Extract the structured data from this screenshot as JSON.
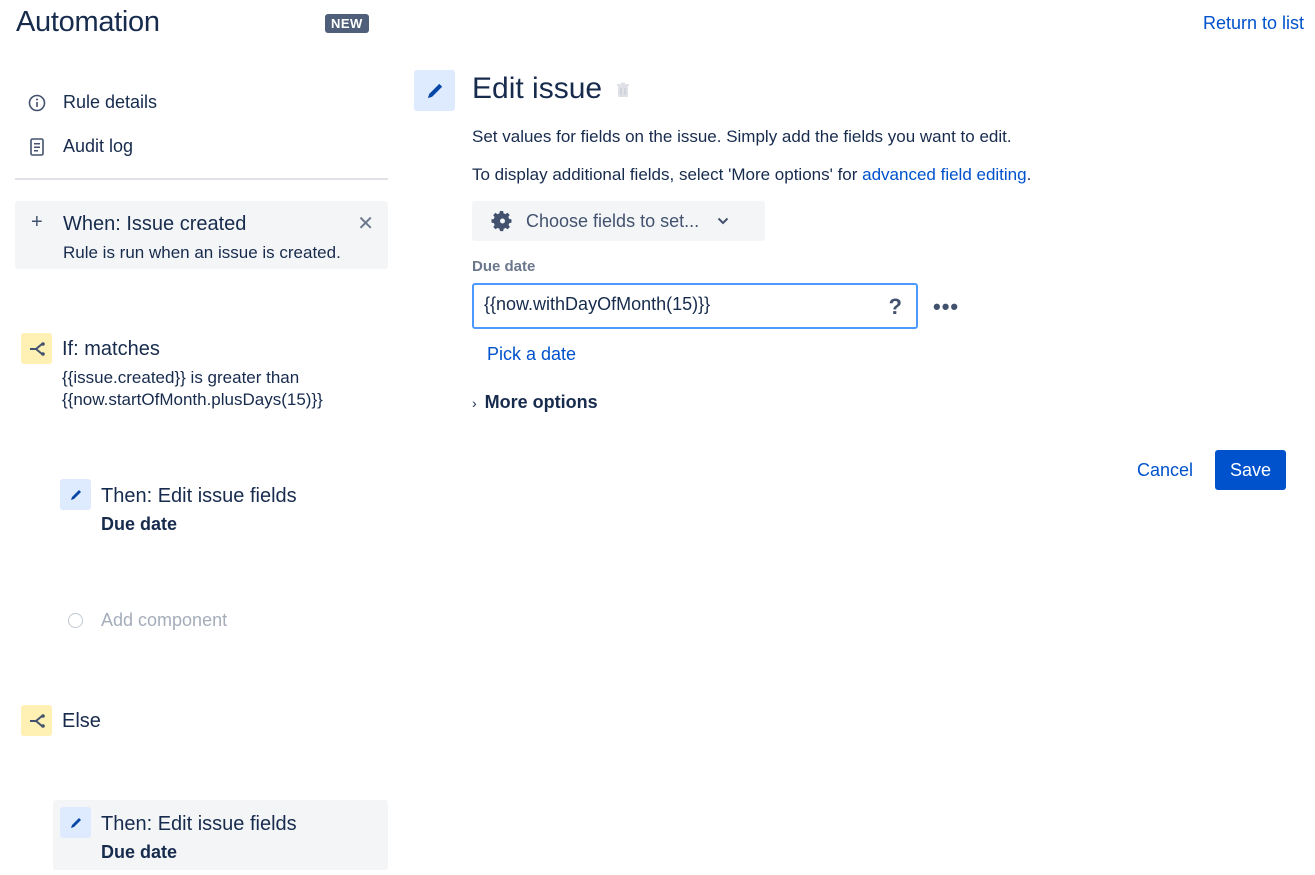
{
  "header": {
    "title": "Automation",
    "badge": "NEW",
    "return_link": "Return to list"
  },
  "sidebar": {
    "nav": [
      {
        "label": "Rule details",
        "icon": "info-icon"
      },
      {
        "label": "Audit log",
        "icon": "document-icon"
      }
    ],
    "trigger": {
      "title": "When: Issue created",
      "subtitle": "Rule is run when an issue is created."
    },
    "condition": {
      "title": "If: matches",
      "line1": "{{issue.created}} is greater than",
      "line2": "{{now.startOfMonth.plusDays(15)}}"
    },
    "then1": {
      "title": "Then: Edit issue fields",
      "subtitle": "Due date"
    },
    "add_component": "Add component",
    "else": {
      "title": "Else"
    },
    "then2": {
      "title": "Then: Edit issue fields",
      "subtitle": "Due date"
    }
  },
  "panel": {
    "title": "Edit issue",
    "description": "Set values for fields on the issue. Simply add the fields you want to edit.",
    "description2_prefix": "To display additional fields, select 'More options' for ",
    "description2_link": "advanced field editing",
    "description2_suffix": ".",
    "choose_fields": "Choose fields to set...",
    "field_label": "Due date",
    "field_value": "{{now.withDayOfMonth(15)}}",
    "help_glyph": "?",
    "more_glyph": "•••",
    "pick_date": "Pick a date",
    "more_options": "More options",
    "cancel": "Cancel",
    "save": "Save"
  },
  "colors": {
    "primary": "#0052cc",
    "text": "#172b4d",
    "condition_bg": "#fff0b3",
    "action_bg": "#deebff",
    "card_bg": "#f4f5f7",
    "focus_border": "#4c9aff"
  }
}
